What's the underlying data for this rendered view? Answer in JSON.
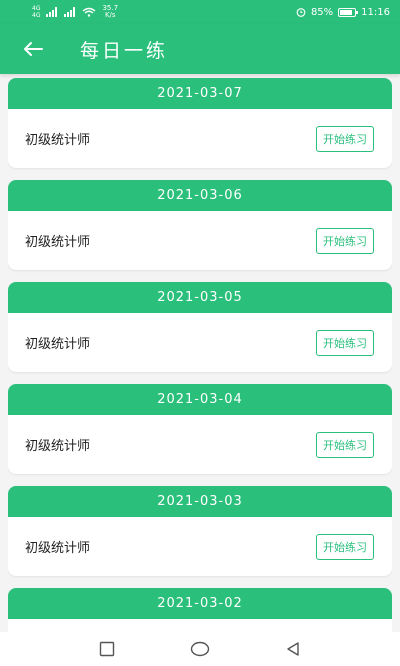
{
  "status_bar": {
    "network_type_1": "4G",
    "network_type_2": "4G",
    "speed_value": "35.7",
    "speed_unit": "K/s",
    "battery": "85%",
    "time": "11:16"
  },
  "header": {
    "title": "每日一练"
  },
  "cards": [
    {
      "date": "2021-03-07",
      "course": "初级统计师",
      "button": "开始练习"
    },
    {
      "date": "2021-03-06",
      "course": "初级统计师",
      "button": "开始练习"
    },
    {
      "date": "2021-03-05",
      "course": "初级统计师",
      "button": "开始练习"
    },
    {
      "date": "2021-03-04",
      "course": "初级统计师",
      "button": "开始练习"
    },
    {
      "date": "2021-03-03",
      "course": "初级统计师",
      "button": "开始练习"
    },
    {
      "date": "2021-03-02",
      "course": "",
      "button": ""
    }
  ],
  "colors": {
    "accent": "#2bbf7c",
    "background": "#f4f4f4"
  }
}
